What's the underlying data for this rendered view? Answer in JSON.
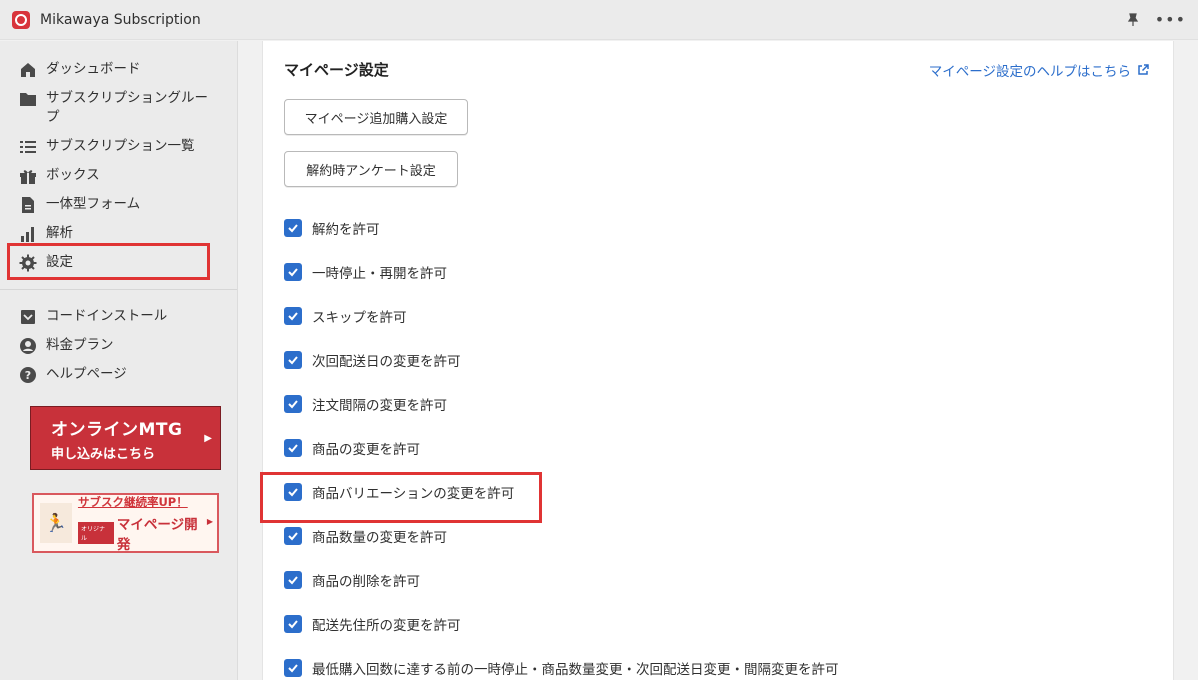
{
  "app": {
    "title": "Mikawaya Subscription"
  },
  "topbar": {
    "pin_icon": "pin-icon",
    "more_icon": "more-horizontal-icon"
  },
  "sidebar": {
    "items": [
      {
        "label": "ダッシュボード",
        "icon": "home-icon"
      },
      {
        "label": "サブスクリプショングループ",
        "icon": "folder-icon"
      },
      {
        "label": "サブスクリプション一覧",
        "icon": "list-icon"
      },
      {
        "label": "ボックス",
        "icon": "gift-icon"
      },
      {
        "label": "一体型フォーム",
        "icon": "document-icon"
      },
      {
        "label": "解析",
        "icon": "bar-chart-icon"
      },
      {
        "label": "設定",
        "icon": "gear-icon"
      }
    ],
    "secondary_items": [
      {
        "label": "コードインストール",
        "icon": "install-icon"
      },
      {
        "label": "料金プラン",
        "icon": "user-circle-icon"
      },
      {
        "label": "ヘルプページ",
        "icon": "question-icon"
      }
    ],
    "banner_mtg": {
      "line1": "オンラインMTG",
      "line2": "申し込みはこちら"
    },
    "banner_mypage": {
      "line1": "サブスク継続率UP！",
      "tag": "オリジナル",
      "line2": "マイページ開発"
    }
  },
  "main": {
    "title": "マイページ設定",
    "help_link": "マイページ設定のヘルプはこちら",
    "buttons": {
      "additional_purchase": "マイページ追加購入設定",
      "cancel_survey": "解約時アンケート設定"
    },
    "checkboxes": [
      {
        "label": "解約を許可",
        "checked": true
      },
      {
        "label": "一時停止・再開を許可",
        "checked": true
      },
      {
        "label": "スキップを許可",
        "checked": true
      },
      {
        "label": "次回配送日の変更を許可",
        "checked": true
      },
      {
        "label": "注文間隔の変更を許可",
        "checked": true
      },
      {
        "label": "商品の変更を許可",
        "checked": true
      },
      {
        "label": "商品バリエーションの変更を許可",
        "checked": true
      },
      {
        "label": "商品数量の変更を許可",
        "checked": true
      },
      {
        "label": "商品の削除を許可",
        "checked": true
      },
      {
        "label": "配送先住所の変更を許可",
        "checked": true
      },
      {
        "label": "最低購入回数に達する前の一時停止・商品数量変更・次回配送日変更・間隔変更を許可",
        "checked": true
      }
    ]
  },
  "colors": {
    "accent": "#2c6ecb",
    "highlight": "#e03434",
    "brand": "#c8313a"
  }
}
